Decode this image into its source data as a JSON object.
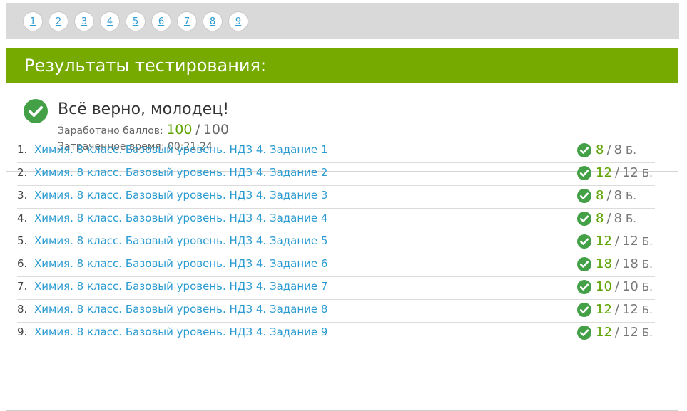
{
  "pagination": {
    "pages": [
      "1",
      "2",
      "3",
      "4",
      "5",
      "6",
      "7",
      "8",
      "9"
    ]
  },
  "results": {
    "title": "Результаты тестирования:",
    "status": "Всё верно, молодец!",
    "score_label": "Заработано баллов:",
    "score_got": "100",
    "score_sep": "/",
    "score_total": "100",
    "time_label": "Затраченное время:",
    "time_value": "00:21:24"
  },
  "tasks": [
    {
      "num": "1.",
      "title": "Химия. 8 класс. Базовый уровень. НДЗ 4. Задание 1",
      "got": "8",
      "max": "8"
    },
    {
      "num": "2.",
      "title": "Химия. 8 класс. Базовый уровень. НДЗ 4. Задание 2",
      "got": "12",
      "max": "12"
    },
    {
      "num": "3.",
      "title": "Химия. 8 класс. Базовый уровень. НДЗ 4. Задание 3",
      "got": "8",
      "max": "8"
    },
    {
      "num": "4.",
      "title": "Химия. 8 класс. Базовый уровень. НДЗ 4. Задание 4",
      "got": "8",
      "max": "8"
    },
    {
      "num": "5.",
      "title": "Химия. 8 класс. Базовый уровень. НДЗ 4. Задание 5",
      "got": "12",
      "max": "12"
    },
    {
      "num": "6.",
      "title": "Химия. 8 класс. Базовый уровень. НДЗ 4. Задание 6",
      "got": "18",
      "max": "18"
    },
    {
      "num": "7.",
      "title": "Химия. 8 класс. Базовый уровень. НДЗ 4. Задание 7",
      "got": "10",
      "max": "10"
    },
    {
      "num": "8.",
      "title": "Химия. 8 класс. Базовый уровень. НДЗ 4. Задание 8",
      "got": "12",
      "max": "12"
    },
    {
      "num": "9.",
      "title": "Химия. 8 класс. Базовый уровень. НДЗ 4. Задание 9",
      "got": "12",
      "max": "12"
    }
  ],
  "task_score_sep": "/",
  "task_unit": "Б.",
  "colors": {
    "accent_green": "#76aa00",
    "check_green": "#43a047",
    "link_blue": "#2a9bd1"
  },
  "icons": {
    "status": "check-circle-icon"
  }
}
